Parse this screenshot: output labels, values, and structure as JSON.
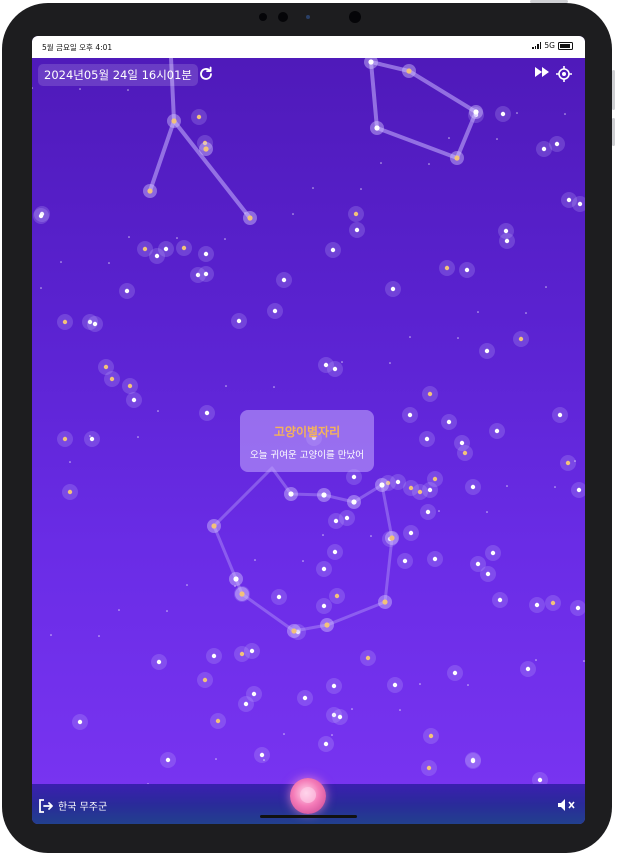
{
  "status_bar": {
    "time": "5월 금요일 오후 4:01",
    "network": "5G"
  },
  "header": {
    "datetime": "2024년05월 24일 16시01분",
    "refresh_icon": "refresh-icon",
    "fast_forward_icon": "fast-forward-icon",
    "locate_icon": "crosshair-icon"
  },
  "tooltip": {
    "title": "고양이별자리",
    "subtitle": "오늘 귀여운 고양이를 만났어"
  },
  "footer": {
    "location": "한국 무주군",
    "exit_icon": "exit-icon",
    "mute_icon": "mute-icon"
  },
  "colors": {
    "sky_top": "#4e19b8",
    "sky_bottom": "#7a35f2",
    "title_accent": "#f4b25b",
    "orb": "#f47bb8"
  }
}
